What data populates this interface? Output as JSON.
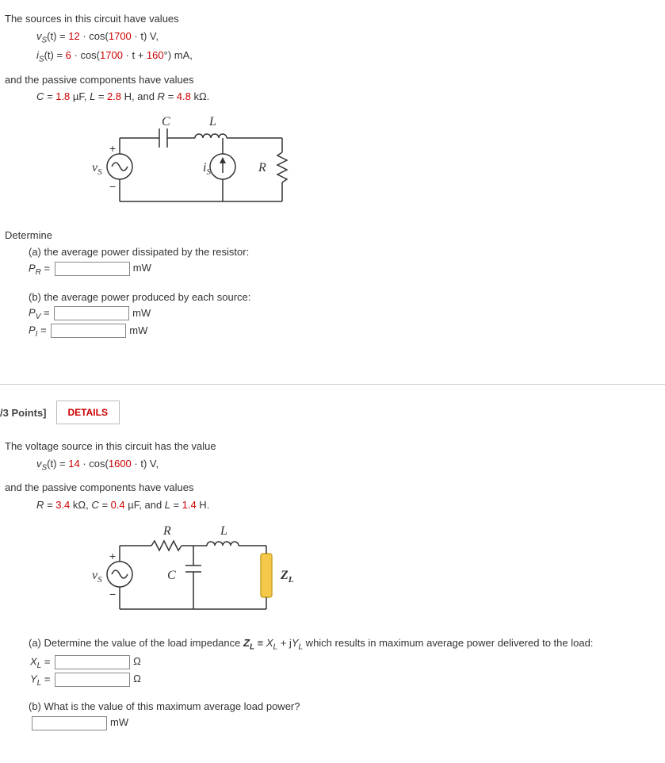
{
  "q1": {
    "intro": "The sources in this circuit have values",
    "vs_prefix": "v",
    "vs_sub": "S",
    "vs_eq": "(t) = ",
    "vs_coeff": "12",
    "vs_mid": " · cos(",
    "vs_omega": "1700",
    "vs_tail": " · t) V,",
    "is_prefix": "i",
    "is_sub": "S",
    "is_eq": "(t) = ",
    "is_coeff": "6",
    "is_mid": " · cos(",
    "is_omega": "1700",
    "is_arg_tail": " · t + ",
    "is_phase": "160",
    "is_tail": "°) mA,",
    "passives_intro": "and the passive components have values",
    "C_label": "C = ",
    "C_val": "1.8",
    "C_unit": " µF, ",
    "L_label": "L = ",
    "L_val": "2.8",
    "L_unit": " H, and ",
    "R_label": "R = ",
    "R_val": "4.8",
    "R_unit": " kΩ.",
    "determine": "Determine",
    "a_text": "(a) the average power dissipated by the resistor:",
    "PR_sym": "P",
    "PR_sub": "R",
    "eq": " = ",
    "mW": "mW",
    "b_text": "(b) the average power produced by each source:",
    "PV_sym": "P",
    "PV_sub": "V",
    "PI_sym": "P",
    "PI_sub": "I",
    "circuit": {
      "C": "C",
      "L": "L",
      "vs": "v",
      "vs_sub": "S",
      "is": "i",
      "is_sub": "S",
      "R": "R",
      "plus": "+",
      "minus": "−"
    }
  },
  "points": {
    "label": "/3 Points]",
    "details": "DETAILS"
  },
  "q2": {
    "intro": "The voltage source in this circuit has the value",
    "vs_prefix": "v",
    "vs_sub": "S",
    "vs_eq": "(t) = ",
    "vs_coeff": "14",
    "vs_mid": " · cos(",
    "vs_omega": "1600",
    "vs_tail": " · t) V,",
    "passives_intro": "and the passive components have values",
    "R_label": "R = ",
    "R_val": "3.4",
    "R_unit": " kΩ, ",
    "C_label": "C = ",
    "C_val": "0.4",
    "C_unit": " µF, and ",
    "L_label": "L = ",
    "L_val": "1.4",
    "L_unit": " H.",
    "a_pre": "(a) Determine the value of the load impedance ",
    "ZL": "Z",
    "ZL_sub": "L",
    "equiv": " ≡ ",
    "XL": "X",
    "XL_sub": "L",
    "plusj": " + j",
    "YL": "Y",
    "YL_sub": "L",
    "a_post": " which results in maximum average power delivered to the load:",
    "ohm": "Ω",
    "b_text": "(b) What is the value of this maximum average load power?",
    "mW": "mW",
    "circuit": {
      "R": "R",
      "L": "L",
      "C": "C",
      "vs": "v",
      "vs_sub": "S",
      "ZL": "Z",
      "ZL_sub": "L",
      "plus": "+",
      "minus": "−"
    }
  }
}
